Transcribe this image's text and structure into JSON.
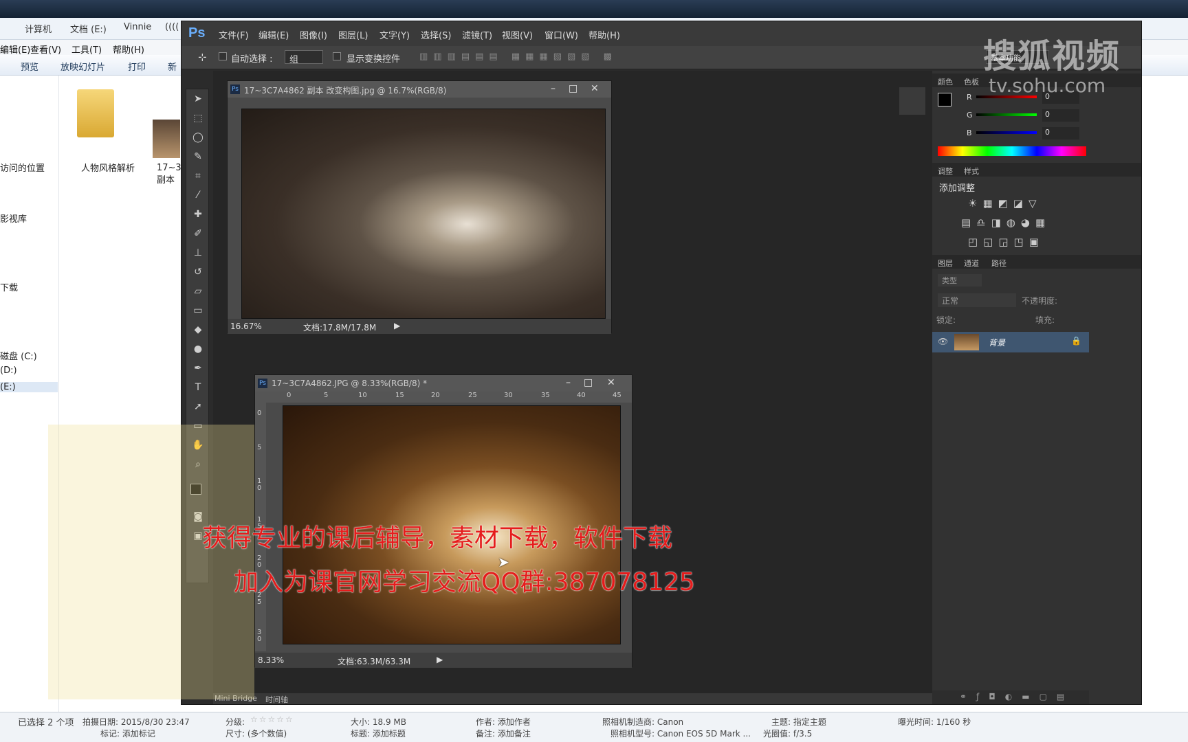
{
  "explorer": {
    "breadcrumb": [
      "计算机",
      "文档 (E:)",
      "Vinnie",
      "(((("
    ],
    "menu": [
      "编辑(E)",
      "查看(V)",
      "工具(T)",
      "帮助(H)"
    ],
    "toolbar": [
      "预览",
      "放映幻灯片",
      "打印",
      "新"
    ],
    "nav": [
      "访问的位置",
      "影视库",
      "下载",
      "磁盘 (C:)",
      "(D:)",
      "(E:)"
    ],
    "files": [
      {
        "name": "人物风格解析"
      },
      {
        "name": "17~3 副本"
      }
    ],
    "status": {
      "selected": "已选择 2 个项",
      "date": "拍摄日期: 2015/8/30 23:47",
      "tags": "标记: 添加标记",
      "rating": "分级:",
      "dims": "尺寸: (多个数值)",
      "size": "大小: 18.9 MB",
      "title": "标题: 添加标题",
      "author": "作者: 添加作者",
      "comment": "备注: 添加备注",
      "maker": "照相机制造商: Canon",
      "model": "照相机型号: Canon EOS 5D Mark ...",
      "subject": "主题: 指定主题",
      "aperture": "光圈值: f/3.5",
      "exposure": "曝光时间: 1/160 秒"
    }
  },
  "ps": {
    "logo": "Ps",
    "menu": [
      "文件(F)",
      "编辑(E)",
      "图像(I)",
      "图层(L)",
      "文字(Y)",
      "选择(S)",
      "滤镜(T)",
      "视图(V)",
      "窗口(W)",
      "帮助(H)"
    ],
    "options": {
      "auto_select": "自动选择 :",
      "group": "组",
      "show_transform": "显示变换控件",
      "workspace": "基本功能"
    },
    "doc1": {
      "title": "17~3C7A4862 副本 改变构图.jpg @ 16.7%(RGB/8)",
      "zoom": "16.67%",
      "docsize": "文档:17.8M/17.8M"
    },
    "doc2": {
      "title": "17~3C7A4862.JPG @ 8.33%(RGB/8) *",
      "zoom": "8.33%",
      "docsize": "文档:63.3M/63.3M",
      "ruler_top": [
        "0",
        "5",
        "10",
        "15",
        "20",
        "25",
        "30",
        "35",
        "40",
        "45"
      ],
      "ruler_left": [
        "0",
        "5",
        "1 0",
        "1 5",
        "2 0",
        "2 5",
        "3 0"
      ]
    },
    "color_panel": {
      "tab1": "颜色",
      "tab2": "色板",
      "r": "0",
      "g": "0",
      "b": "0"
    },
    "adjust_panel": {
      "tab1": "调整",
      "tab2": "样式",
      "title": "添加调整"
    },
    "layers_panel": {
      "tabs": [
        "图层",
        "通道",
        "路径"
      ],
      "kind": "类型",
      "blend": "正常",
      "opacity_label": "不透明度:",
      "lock_label": "锁定:",
      "fill_label": "填充:",
      "layer_name": "背景"
    },
    "bottom_tabs": [
      "Mini Bridge",
      "时间轴"
    ]
  },
  "overlay": {
    "line1": "获得专业的课后辅导，素材下载，软件下载",
    "line2": "加入为课官网学习交流QQ群:387078125",
    "watermark": "搜狐视频",
    "watermark_url": "tv.sohu.com"
  }
}
